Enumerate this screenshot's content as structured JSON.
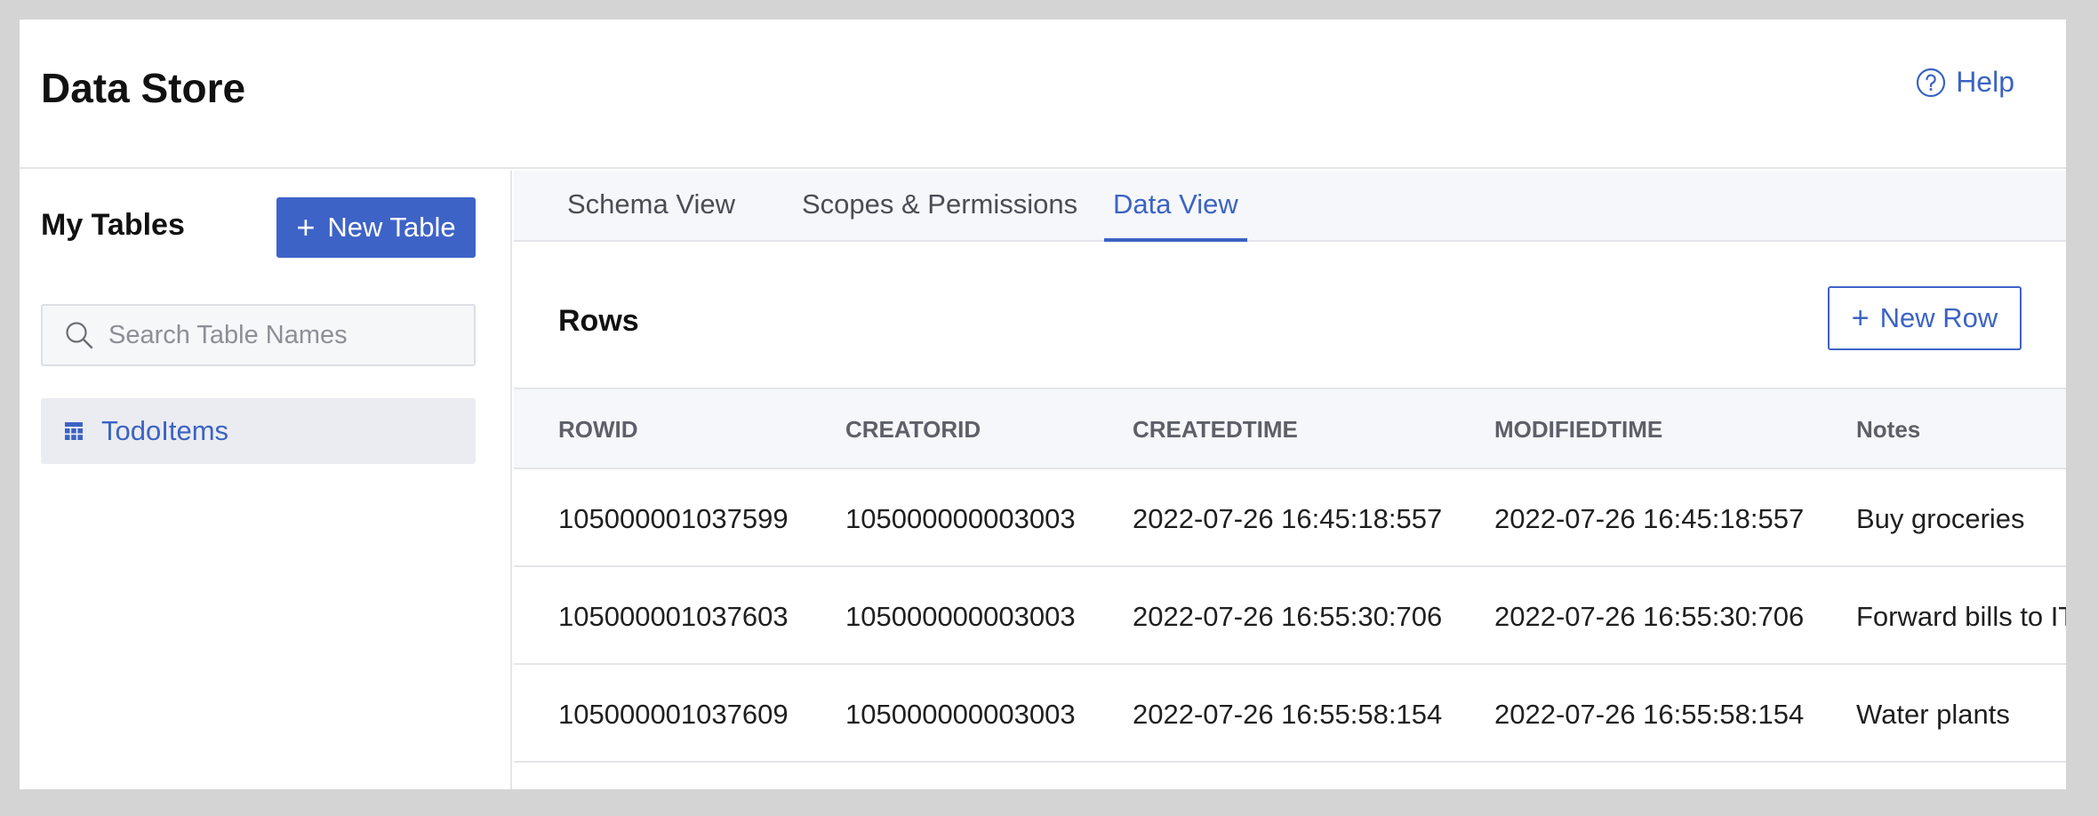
{
  "header": {
    "title": "Data Store",
    "help_label": "Help"
  },
  "sidebar": {
    "title": "My Tables",
    "new_table_label": "New Table",
    "search_placeholder": "Search Table Names",
    "tables": [
      {
        "label": "TodoItems"
      }
    ]
  },
  "main": {
    "tabs": [
      {
        "label": "Schema View"
      },
      {
        "label": "Scopes & Permissions"
      },
      {
        "label": "Data View"
      }
    ],
    "active_tab": "Data View",
    "rows_title": "Rows",
    "new_row_label": "New Row",
    "columns": [
      "ROWID",
      "CREATORID",
      "CREATEDTIME",
      "MODIFIEDTIME",
      "Notes"
    ],
    "rows": [
      [
        "105000001037599",
        "105000000003003",
        "2022-07-26 16:45:18:557",
        "2022-07-26 16:45:18:557",
        "Buy groceries"
      ],
      [
        "105000001037603",
        "105000000003003",
        "2022-07-26 16:55:30:706",
        "2022-07-26 16:55:30:706",
        "Forward bills to IT"
      ],
      [
        "105000001037609",
        "105000000003003",
        "2022-07-26 16:55:58:154",
        "2022-07-26 16:55:58:154",
        "Water plants"
      ]
    ]
  },
  "colors": {
    "accent": "#3e63c7",
    "link": "#3b63c4",
    "border": "#e3e5ea",
    "header_bg": "#f6f7fa"
  },
  "icons": {
    "help": "question-circle-icon",
    "add": "plus-icon",
    "search": "search-icon",
    "table": "table-grid-icon"
  }
}
